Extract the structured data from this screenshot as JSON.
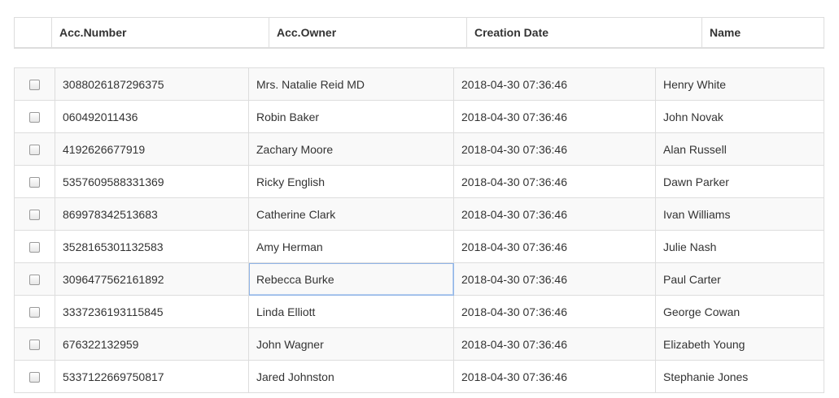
{
  "columns": [
    "Acc.Number",
    "Acc.Owner",
    "Creation Date",
    "Name"
  ],
  "rows": [
    {
      "acc_number": "3088026187296375",
      "acc_owner": "Mrs. Natalie Reid MD",
      "creation_date": "2018-04-30 07:36:46",
      "name": "Henry White"
    },
    {
      "acc_number": "060492011436",
      "acc_owner": "Robin Baker",
      "creation_date": "2018-04-30 07:36:46",
      "name": "John Novak"
    },
    {
      "acc_number": "4192626677919",
      "acc_owner": "Zachary Moore",
      "creation_date": "2018-04-30 07:36:46",
      "name": "Alan Russell"
    },
    {
      "acc_number": "5357609588331369",
      "acc_owner": "Ricky English",
      "creation_date": "2018-04-30 07:36:46",
      "name": "Dawn Parker"
    },
    {
      "acc_number": "869978342513683",
      "acc_owner": "Catherine Clark",
      "creation_date": "2018-04-30 07:36:46",
      "name": "Ivan Williams"
    },
    {
      "acc_number": "3528165301132583",
      "acc_owner": "Amy Herman",
      "creation_date": "2018-04-30 07:36:46",
      "name": "Julie Nash"
    },
    {
      "acc_number": "3096477562161892",
      "acc_owner": "Rebecca Burke",
      "creation_date": "2018-04-30 07:36:46",
      "name": "Paul Carter"
    },
    {
      "acc_number": "3337236193115845",
      "acc_owner": "Linda Elliott",
      "creation_date": "2018-04-30 07:36:46",
      "name": "George Cowan"
    },
    {
      "acc_number": "676322132959",
      "acc_owner": "John Wagner",
      "creation_date": "2018-04-30 07:36:46",
      "name": "Elizabeth Young"
    },
    {
      "acc_number": "5337122669750817",
      "acc_owner": "Jared Johnston",
      "creation_date": "2018-04-30 07:36:46",
      "name": "Stephanie Jones"
    }
  ]
}
